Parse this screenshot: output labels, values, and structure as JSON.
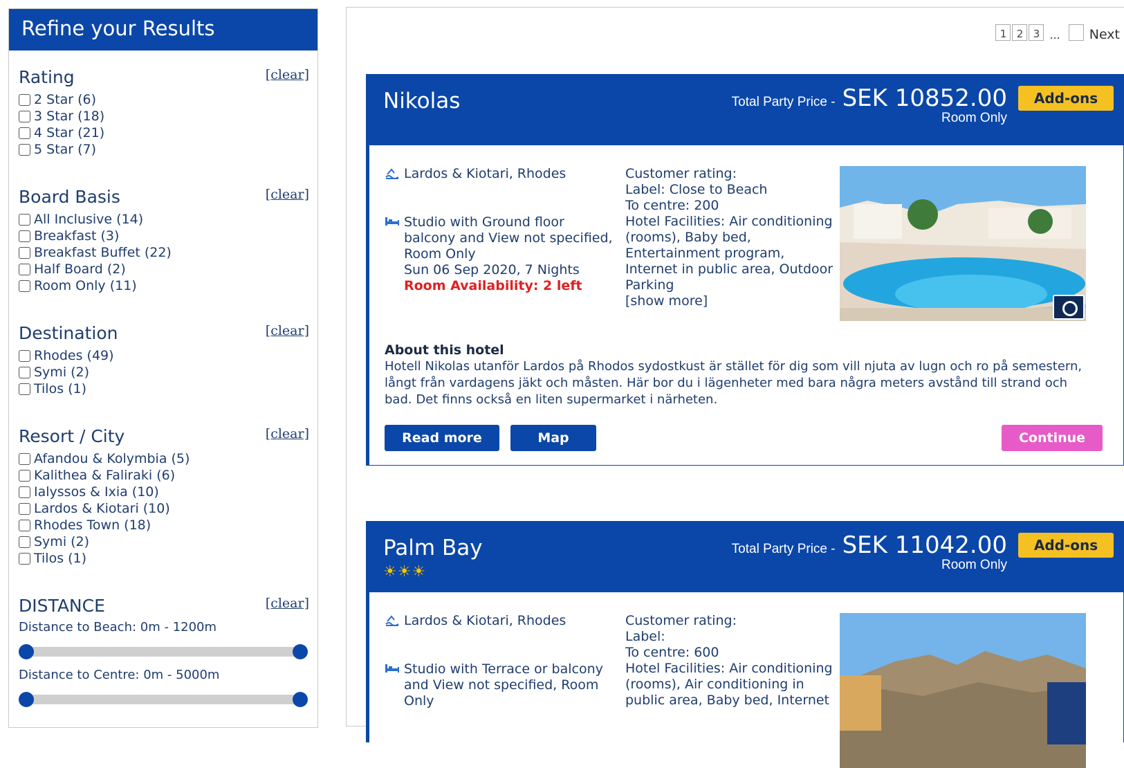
{
  "sidebar": {
    "title": "Refine your Results",
    "clear_label": "[clear]",
    "rating": {
      "title": "Rating",
      "options": [
        "2 Star (6)",
        "3 Star (18)",
        "4 Star (21)",
        "5 Star (7)"
      ]
    },
    "board_basis": {
      "title": "Board Basis",
      "options": [
        "All Inclusive (14)",
        "Breakfast (3)",
        "Breakfast Buffet (22)",
        "Half Board (2)",
        "Room Only (11)"
      ]
    },
    "destination": {
      "title": "Destination",
      "options": [
        "Rhodes (49)",
        "Symi (2)",
        "Tilos (1)"
      ]
    },
    "resort": {
      "title": "Resort / City",
      "options": [
        "Afandou & Kolymbia (5)",
        "Kalithea & Faliraki (6)",
        "Ialyssos & Ixia (10)",
        "Lardos & Kiotari (10)",
        "Rhodes Town (18)",
        "Symi (2)",
        "Tilos (1)"
      ]
    },
    "distance": {
      "title": "DISTANCE",
      "beach_label": "Distance to Beach: 0m - 1200m",
      "centre_label": "Distance to Centre: 0m - 5000m"
    }
  },
  "pagination": {
    "pages": [
      "1",
      "2",
      "3"
    ],
    "ellipsis": "...",
    "next_label": "Next"
  },
  "hotels": [
    {
      "name": "Nikolas",
      "stars": "",
      "price_label": "Total Party Price -",
      "price": "SEK 10852.00",
      "board": "Room Only",
      "addons_label": "Add-ons",
      "location": "Lardos & Kiotari, Rhodes",
      "room_lines": [
        "Studio with Ground floor",
        "balcony and View not specified,",
        "Room Only",
        "Sun 06 Sep 2020, 7 Nights"
      ],
      "availability": "Room Availability: 2 left",
      "details_lines": [
        "Customer rating:",
        "Label: Close to Beach",
        "To centre: 200",
        "Hotel Facilities: Air conditioning",
        "(rooms), Baby bed,",
        "Entertainment program,",
        "Internet in public area, Outdoor",
        "Parking",
        "[show more]"
      ],
      "about_title": "About this hotel",
      "about_text": "Hotell Nikolas utanför Lardos på Rhodos sydostkust är stället för dig som vill njuta av lugn och ro på semestern, långt från vardagens jäkt och måsten. Här bor du i lägenheter med bara några meters avstånd till strand och bad. Det finns också en liten supermarket i närheten.",
      "read_more_label": "Read more",
      "map_label": "Map",
      "continue_label": "Continue"
    },
    {
      "name": "Palm Bay",
      "stars": "☀☀☀",
      "price_label": "Total Party Price -",
      "price": "SEK 11042.00",
      "board": "Room Only",
      "addons_label": "Add-ons",
      "location": "Lardos & Kiotari, Rhodes",
      "room_lines": [
        "Studio with Terrace or balcony",
        "and View not specified, Room",
        "Only"
      ],
      "details_lines": [
        "Customer rating:",
        "Label:",
        "To centre: 600",
        "Hotel Facilities: Air conditioning",
        "(rooms), Air conditioning in",
        "public area, Baby bed, Internet"
      ]
    }
  ],
  "colors": {
    "brand_blue": "#0b47a8",
    "addons_yellow": "#f5c021",
    "continue_pink": "#e65bc7",
    "availability_red": "#e02020"
  },
  "icons": {
    "location": "beach-wave-icon",
    "room": "bed-icon",
    "gallery": "camera-icon",
    "rating": "sun-star-icon"
  }
}
